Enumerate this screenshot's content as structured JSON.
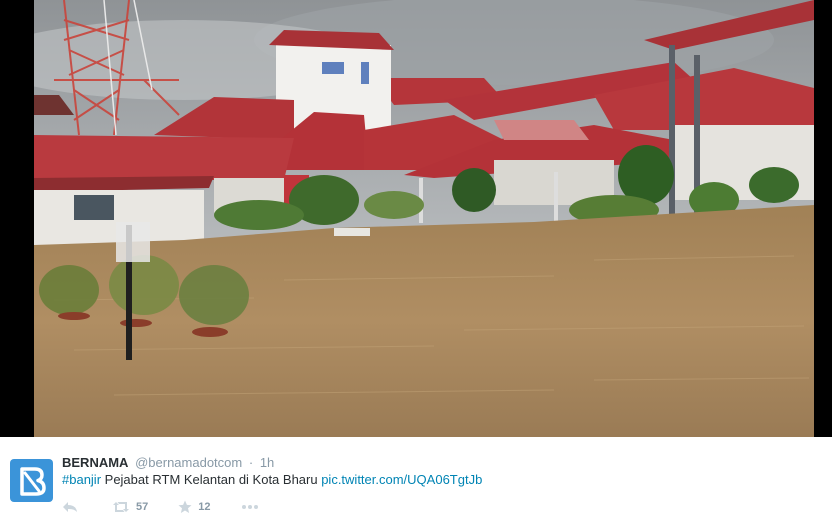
{
  "tweet": {
    "display_name": "BERNAMA",
    "username": "@bernamadotcom",
    "separator": "·",
    "time": "1h",
    "hashtag": "#banjir",
    "text": " Pejabat RTM Kelantan di Kota Bharu ",
    "link": "pic.twitter.com/UQA06TgtJb"
  },
  "actions": {
    "retweet_count": "57",
    "favorite_count": "12"
  },
  "icons": {
    "avatar": "bernama-logo-icon",
    "reply": "reply-icon",
    "retweet": "retweet-icon",
    "favorite": "star-icon",
    "more": "more-icon"
  },
  "colors": {
    "link": "#0084b4",
    "avatar_bg": "#3b94d9",
    "muted": "#8899a6",
    "text": "#292f33"
  }
}
